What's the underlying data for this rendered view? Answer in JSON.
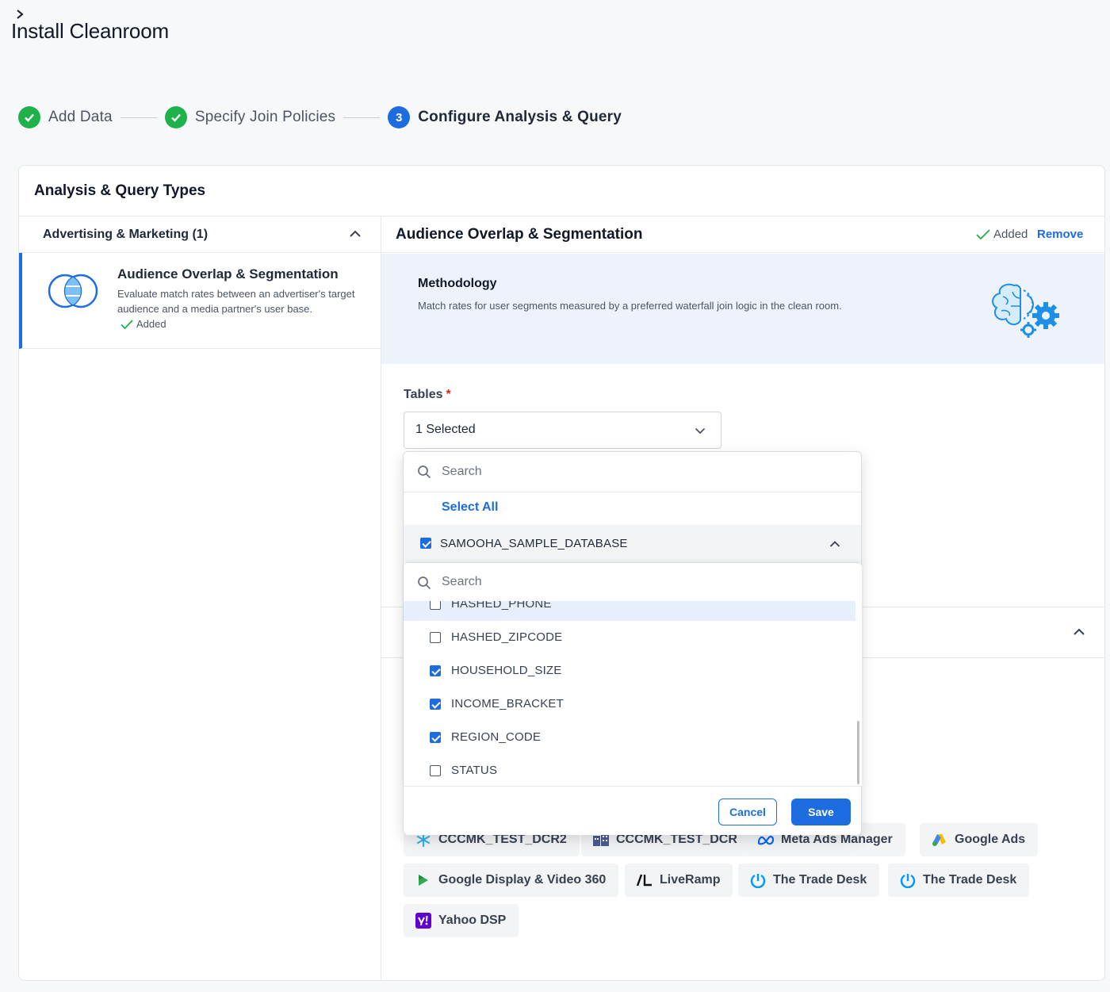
{
  "page": {
    "title": "Install Cleanroom",
    "back_icon": "chevron-right-icon"
  },
  "stepper": {
    "steps": [
      {
        "label": "Add Data",
        "state": "done"
      },
      {
        "label": "Specify Join Policies",
        "state": "done"
      },
      {
        "label": "Configure Analysis & Query",
        "state": "active",
        "number": "3"
      }
    ]
  },
  "card": {
    "title": "Analysis & Query Types"
  },
  "left": {
    "category": "Advertising & Marketing (1)",
    "item": {
      "title": "Audience Overlap & Segmentation",
      "description": "Evaluate match rates between an advertiser's target audience and a media partner's user base.",
      "status": "Added"
    }
  },
  "right": {
    "title": "Audience Overlap & Segmentation",
    "added": "Added",
    "remove": "Remove",
    "methodology": {
      "title": "Methodology",
      "description": "Match rates for user segments measured by a preferred waterfall join logic in the clean room."
    },
    "tables": {
      "label": "Tables",
      "required": "*",
      "value": "1 Selected"
    },
    "chips": [
      {
        "label": "CCCMK_TEST_DCR2",
        "icon": "snowflake-icon"
      },
      {
        "label": "CCCMK_TEST_DCR",
        "icon": "building-icon"
      },
      {
        "label": "Meta Ads Manager",
        "icon": "meta-icon"
      },
      {
        "label": "Google Ads",
        "icon": "google-ads-icon"
      },
      {
        "label": "Google Display & Video 360",
        "icon": "dv360-icon"
      },
      {
        "label": "LiveRamp",
        "icon": "liveramp-icon"
      },
      {
        "label": "The Trade Desk",
        "icon": "trade-desk-icon"
      },
      {
        "label": "The Trade Desk",
        "icon": "trade-desk-icon"
      },
      {
        "label": "Yahoo DSP",
        "icon": "yahoo-icon"
      }
    ]
  },
  "dropdown": {
    "search_placeholder": "Search",
    "select_all": "Select All",
    "database": {
      "name": "SAMOOHA_SAMPLE_DATABASE",
      "checked": true
    },
    "column_search_placeholder": "Search",
    "columns": [
      {
        "name": "HASHED_PHONE",
        "checked": false
      },
      {
        "name": "HASHED_ZIPCODE",
        "checked": false
      },
      {
        "name": "HOUSEHOLD_SIZE",
        "checked": true
      },
      {
        "name": "INCOME_BRACKET",
        "checked": true
      },
      {
        "name": "REGION_CODE",
        "checked": true
      },
      {
        "name": "STATUS",
        "checked": false
      }
    ],
    "cancel": "Cancel",
    "save": "Save"
  },
  "colors": {
    "accent": "#1d6ce0",
    "success": "#1fb14a",
    "required": "#e02424"
  }
}
